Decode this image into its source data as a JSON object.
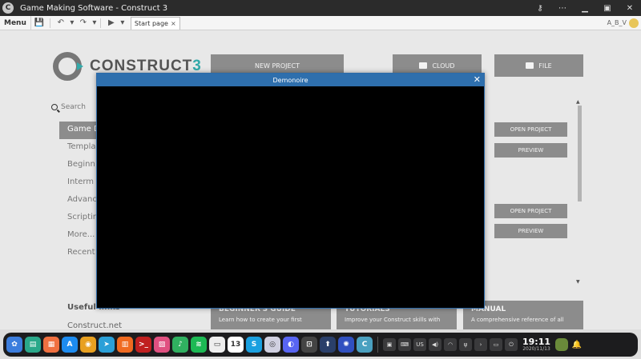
{
  "window": {
    "title": "Game Making Software - Construct 3",
    "logo_letter": "C"
  },
  "window_controls": {
    "key": "⚷",
    "more": "⋯",
    "minimize": "▁",
    "restore": "▣",
    "close": "✕"
  },
  "toolbar": {
    "menu_label": "Menu",
    "save_icon": "💾",
    "undo": "↶",
    "dropdown": "▾",
    "redo": "↷",
    "play": "▶",
    "tab_label": "Start page",
    "tab_close": "×",
    "user_name": "A_B_V"
  },
  "start_page": {
    "logo_text": "CONSTRUCT",
    "logo_num": "3",
    "new_project": "NEW PROJECT",
    "cloud": "CLOUD",
    "file": "FILE",
    "search_placeholder": "Search",
    "nav": [
      "Game D",
      "Templa",
      "Beginn",
      "Interm",
      "Advanc",
      "Scriptir",
      "More...",
      "Recent"
    ],
    "useful_links_title": "Useful links",
    "useful_link_1": "Construct.net",
    "open_project": "OPEN PROJECT",
    "preview": "PREVIEW",
    "scroll_up": "▲",
    "scroll_down": "▼",
    "cards": [
      {
        "title": "BEGINNER'S GUIDE",
        "desc": "Learn how to create your first"
      },
      {
        "title": "TUTORIALS",
        "desc": "Improve your Construct skills with"
      },
      {
        "title": "MANUAL",
        "desc": "A comprehensive reference of all"
      }
    ]
  },
  "dialog": {
    "title": "Demonoire",
    "close": "✕"
  },
  "taskbar": {
    "apps": [
      {
        "glyph": "✿",
        "color": "#3b7ddd"
      },
      {
        "glyph": "▤",
        "color": "#2aa88a"
      },
      {
        "glyph": "▦",
        "color": "#f07040"
      },
      {
        "glyph": "A",
        "color": "#1d8cf0"
      },
      {
        "glyph": "◉",
        "color": "#e8a020"
      },
      {
        "glyph": "➤",
        "color": "#2aa0d8"
      },
      {
        "glyph": "▥",
        "color": "#f06a20"
      },
      {
        "glyph": ">_",
        "color": "#c02020"
      },
      {
        "glyph": "▨",
        "color": "#e05080"
      },
      {
        "glyph": "♪",
        "color": "#30b060"
      },
      {
        "glyph": "≋",
        "color": "#1db954"
      },
      {
        "glyph": "▭",
        "color": "#eeeeee"
      },
      {
        "glyph": "13",
        "color": "#ffffff"
      },
      {
        "glyph": "S",
        "color": "#1aa0e0"
      },
      {
        "glyph": "◎",
        "color": "#d0d0e0"
      },
      {
        "glyph": "◐",
        "color": "#5865f2"
      },
      {
        "glyph": "⊡",
        "color": "#444444"
      },
      {
        "glyph": "⬆",
        "color": "#2a3f6a"
      },
      {
        "glyph": "✺",
        "color": "#3050c0"
      },
      {
        "glyph": "C",
        "color": "#4aa0c0"
      }
    ],
    "tray": [
      "▣",
      "⌨",
      "US",
      "◀)",
      "◠",
      "ψ",
      "›",
      "▭",
      "⏻"
    ],
    "time": "19:11",
    "date": "2020/11/13"
  }
}
